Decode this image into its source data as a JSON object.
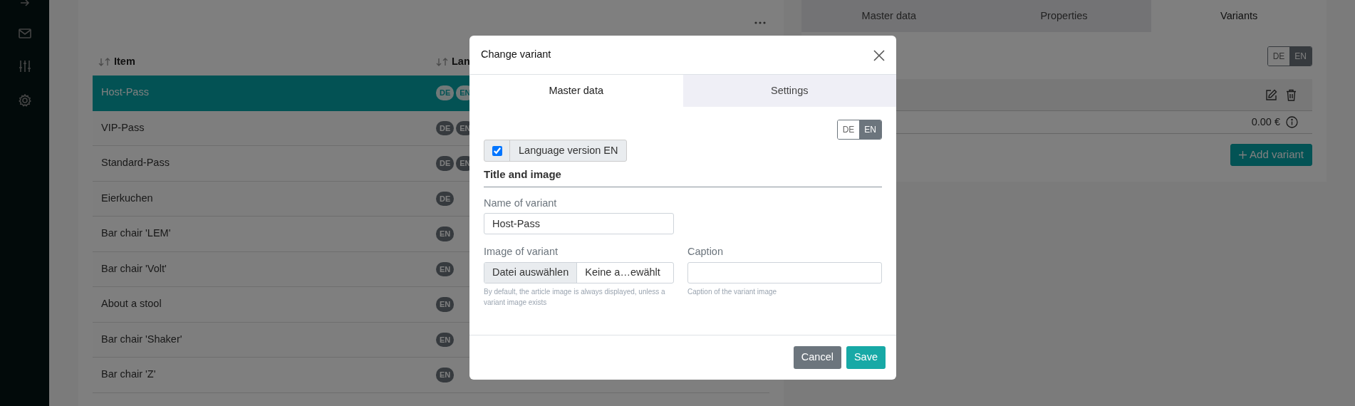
{
  "table": {
    "columns": [
      "Item",
      "Lan"
    ],
    "rows": [
      {
        "item": "Host-Pass",
        "languages": [
          "DE",
          "EN"
        ],
        "selected": true
      },
      {
        "item": "VIP-Pass",
        "languages": [
          "DE",
          "EN"
        ],
        "selected": false
      },
      {
        "item": "Standard-Pass",
        "languages": [
          "DE",
          "EN"
        ],
        "selected": false
      },
      {
        "item": "Eierkuchen",
        "languages": [
          "DE"
        ],
        "selected": false
      },
      {
        "item": "Bar chair 'LEM'",
        "languages": [
          "EN"
        ],
        "selected": false
      },
      {
        "item": "Bar chair 'Volt'",
        "languages": [
          "EN"
        ],
        "selected": false
      },
      {
        "item": "About a stool",
        "languages": [
          "EN"
        ],
        "selected": false
      },
      {
        "item": "Bar chair 'Shaker'",
        "languages": [
          "EN"
        ],
        "selected": false
      },
      {
        "item": "Bar chair 'Z'",
        "languages": [
          "EN"
        ],
        "selected": false
      }
    ]
  },
  "product_panel": {
    "tabs": [
      {
        "label": "Master data",
        "selected": false
      },
      {
        "label": "Properties",
        "selected": false
      },
      {
        "label": "Variants",
        "selected": true
      }
    ],
    "language_toggle": [
      {
        "label": "DE",
        "selected": false
      },
      {
        "label": "EN",
        "selected": true
      }
    ],
    "variant": {
      "price": "0.00 €"
    },
    "add_button": "Add variant"
  },
  "modal": {
    "title": "Change variant",
    "tabs": [
      {
        "label": "Master data",
        "selected": true
      },
      {
        "label": "Settings",
        "selected": false
      }
    ],
    "language_toggle": [
      {
        "label": "DE",
        "selected": false
      },
      {
        "label": "EN",
        "selected": true
      }
    ],
    "language_checkbox": {
      "label": "Language version EN",
      "checked": true
    },
    "section_title": "Title and image",
    "name_field": {
      "label": "Name of variant",
      "value": "Host-Pass"
    },
    "image_field": {
      "label": "Image of variant",
      "button": "Datei auswählen",
      "file_name": "Keine a…ewählt",
      "help": "By default, the article image is always displayed, unless a variant image exists"
    },
    "caption_field": {
      "label": "Caption",
      "help": "Caption of the variant image"
    },
    "buttons": [
      {
        "label": "Cancel",
        "kind": "secondary"
      },
      {
        "label": "Save",
        "kind": "primary"
      }
    ]
  }
}
